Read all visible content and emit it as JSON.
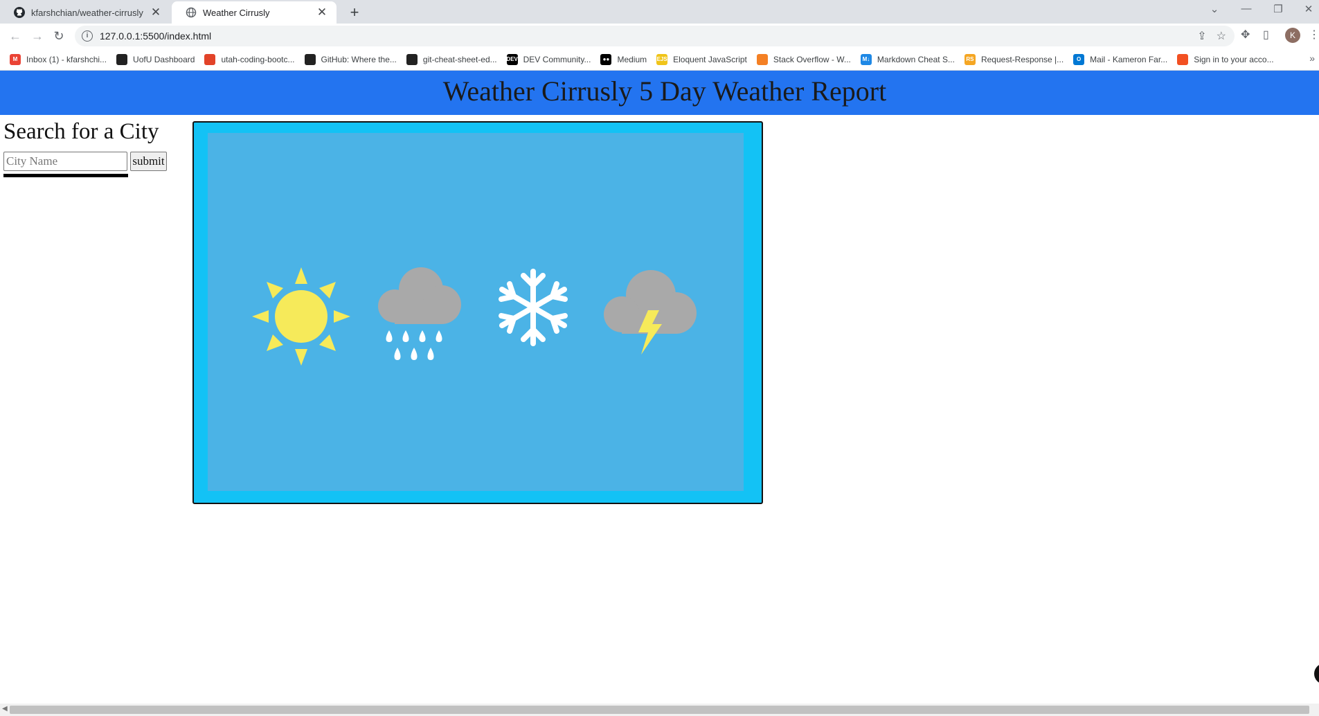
{
  "browser": {
    "tabs": [
      {
        "title": "kfarshchian/weather-cirrusly",
        "active": false,
        "icon": "github-icon"
      },
      {
        "title": "Weather Cirrusly",
        "active": true,
        "icon": "globe-icon"
      }
    ],
    "url": "127.0.0.1:5500/index.html",
    "profile_initial": "K",
    "bookmarks": [
      {
        "label": "Inbox (1) - kfarshchi...",
        "icon": "gmail-icon",
        "color": "#ea4335",
        "glyph": "M"
      },
      {
        "label": "UofU Dashboard",
        "icon": "canvas-icon",
        "color": "#222222",
        "glyph": ""
      },
      {
        "label": "utah-coding-bootc...",
        "icon": "gitlab-icon",
        "color": "#e24329",
        "glyph": ""
      },
      {
        "label": "GitHub: Where the...",
        "icon": "github-icon",
        "color": "#222222",
        "glyph": ""
      },
      {
        "label": "git-cheat-sheet-ed...",
        "icon": "github-icon",
        "color": "#222222",
        "glyph": ""
      },
      {
        "label": "DEV Community...",
        "icon": "dev-icon",
        "color": "#000000",
        "glyph": "DEV"
      },
      {
        "label": "Medium",
        "icon": "medium-icon",
        "color": "#000000",
        "glyph": "●●"
      },
      {
        "label": "Eloquent JavaScript",
        "icon": "ejs-icon",
        "color": "#f0c419",
        "glyph": "EJS"
      },
      {
        "label": "Stack Overflow - W...",
        "icon": "stackoverflow-icon",
        "color": "#f48024",
        "glyph": ""
      },
      {
        "label": "Markdown Cheat S...",
        "icon": "markdown-icon",
        "color": "#1e88e5",
        "glyph": "M↓"
      },
      {
        "label": "Request-Response |...",
        "icon": "request-response-icon",
        "color": "#f5a623",
        "glyph": "RS"
      },
      {
        "label": "Mail - Kameron Far...",
        "icon": "outlook-icon",
        "color": "#0078d4",
        "glyph": "O"
      },
      {
        "label": "Sign in to your acco...",
        "icon": "microsoft-icon",
        "color": "#f25022",
        "glyph": ""
      }
    ]
  },
  "page": {
    "header_title": "Weather Cirrusly 5 Day Weather Report",
    "search_title": "Search for a City",
    "city_placeholder": "City Name",
    "city_value": "",
    "submit_label": "submit",
    "weather_icons": [
      "sun-icon",
      "rain-cloud-icon",
      "snowflake-icon",
      "storm-cloud-icon"
    ],
    "colors": {
      "header_bg": "#2374f0",
      "frame_bg": "#13c2f5",
      "panel_bg": "#4bb3e6",
      "sun": "#f6ea5a",
      "cloud": "#a9a9a9",
      "drop": "#ffffff",
      "bolt": "#f6ea5a"
    }
  }
}
